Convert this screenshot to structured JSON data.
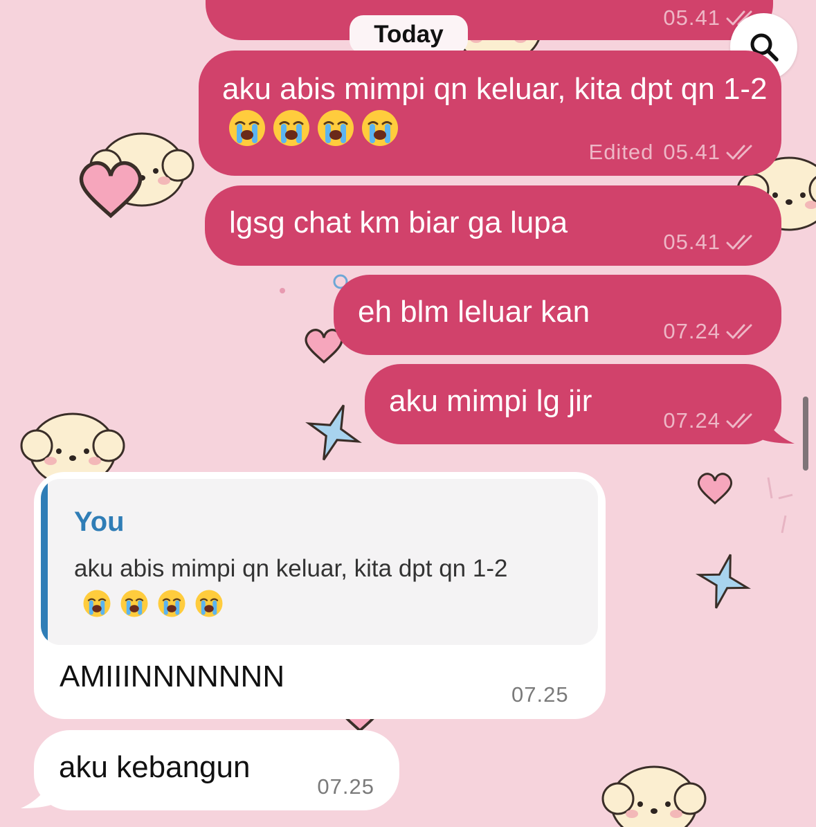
{
  "date_separator": "Today",
  "search": {
    "icon": "search-icon"
  },
  "messages": [
    {
      "direction": "outgoing",
      "text": "",
      "time": "05.41",
      "status": "read"
    },
    {
      "direction": "outgoing",
      "text": "aku abis mimpi qn keluar, kita dpt qn 1-2",
      "emojis": [
        "😭",
        "😭",
        "😭",
        "😭"
      ],
      "edited_label": "Edited",
      "time": "05.41",
      "status": "read"
    },
    {
      "direction": "outgoing",
      "text": "lgsg chat km biar ga lupa",
      "time": "05.41",
      "status": "read"
    },
    {
      "direction": "outgoing",
      "text": "eh blm leluar kan",
      "time": "07.24",
      "status": "read"
    },
    {
      "direction": "outgoing",
      "text": "aku mimpi lg jir",
      "time": "07.24",
      "status": "read"
    },
    {
      "direction": "incoming",
      "reply_to": {
        "sender": "You",
        "text": "aku abis mimpi qn keluar, kita dpt qn 1-2",
        "emojis": [
          "😭",
          "😭",
          "😭",
          "😭"
        ]
      },
      "text": "AMIIINNNNNNN",
      "time": "07.25"
    },
    {
      "direction": "incoming",
      "text": "aku kebangun",
      "time": "07.25"
    }
  ],
  "colors": {
    "background": "#f6d3dc",
    "outgoing_bubble": "#d1426b",
    "incoming_bubble": "#ffffff",
    "reply_accent": "#2f7db6"
  }
}
